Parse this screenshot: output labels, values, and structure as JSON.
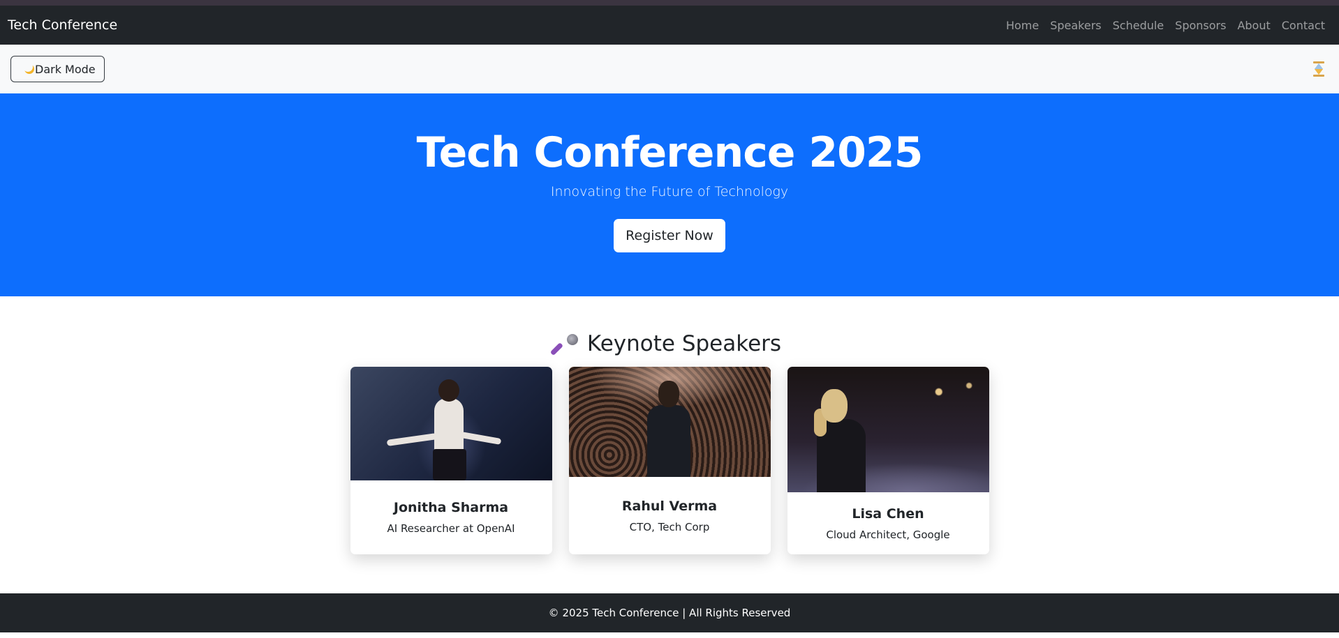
{
  "navbar": {
    "brand": "Tech Conference",
    "links": [
      "Home",
      "Speakers",
      "Schedule",
      "Sponsors",
      "About",
      "Contact"
    ]
  },
  "toolbar": {
    "dark_mode_label": "Dark Mode",
    "dark_mode_icon": "moon-icon",
    "loading_icon": "hourglass-icon"
  },
  "hero": {
    "title": "Tech Conference 2025",
    "subtitle": "Innovating the Future of Technology",
    "cta_label": "Register Now",
    "background_color": "#0d6efd"
  },
  "speakers": {
    "heading": "Keynote Speakers",
    "heading_icon": "microphone-icon",
    "items": [
      {
        "name": "Jonitha Sharma",
        "role": "AI Researcher at OpenAI"
      },
      {
        "name": "Rahul Verma",
        "role": "CTO, Tech Corp"
      },
      {
        "name": "Lisa Chen",
        "role": "Cloud Architect, Google"
      }
    ]
  },
  "footer": {
    "text": "© 2025 Tech Conference | All Rights Reserved"
  },
  "colors": {
    "navbar_bg": "#212529",
    "toolbar_bg": "#f8f9fa",
    "accent": "#0d6efd"
  }
}
